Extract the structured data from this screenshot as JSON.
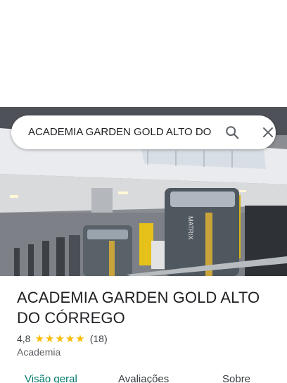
{
  "search": {
    "query": "ACADEMIA GARDEN GOLD ALTO DO CÓRREGO",
    "search_icon": "search-icon",
    "close_icon": "close-icon"
  },
  "hero": {
    "sign_text": "MATRIX"
  },
  "place": {
    "title": "ACADEMIA GARDEN GOLD ALTO DO CÓRREGO",
    "rating": "4,8",
    "stars": 5,
    "review_count": "(18)",
    "category": "Academia"
  },
  "tabs": [
    {
      "label": "Visão geral",
      "active": true
    },
    {
      "label": "Avaliações",
      "active": false
    },
    {
      "label": "Sobre",
      "active": false
    }
  ],
  "colors": {
    "accent": "#00796b",
    "star": "#fbbc04",
    "text": "#202124"
  }
}
